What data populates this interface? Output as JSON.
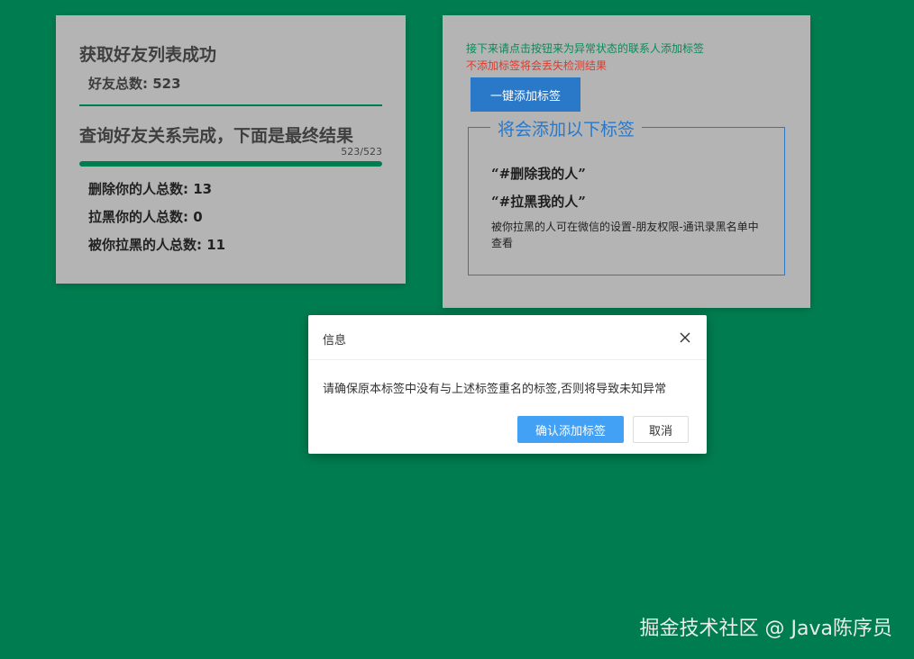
{
  "left_card": {
    "title": "获取好友列表成功",
    "friend_total": "好友总数: 523",
    "relation_title": "查询好友关系完成，下面是最终结果",
    "progress": {
      "text": "523/523",
      "fraction": 1.0
    },
    "stats": [
      "删除你的人总数: 13",
      "拉黑你的人总数: 0",
      "被你拉黑的人总数: 11"
    ]
  },
  "right_card": {
    "hint_green": "接下来请点击按钮来为异常状态的联系人添加标签",
    "hint_red": "不添加标签将会丢失检测结果",
    "add_tags_button": "一键添加标签",
    "legend": "将会添加以下标签",
    "tags": [
      "“#删除我的人”",
      "“#拉黑我的人”"
    ],
    "note": "被你拉黑的人可在微信的设置-朋友权限-通讯录黑名单中查看"
  },
  "dialog": {
    "title": "信息",
    "message": "请确保原本标签中没有与上述标签重名的标签,否则将导致未知异常",
    "confirm_label": "确认添加标签",
    "cancel_label": "取消"
  },
  "watermark": "掘金技术社区 @ Java陈序员",
  "colors": {
    "background": "#007d50",
    "card": "#b4b4b4",
    "accent_blue": "#2a78c8",
    "confirm_blue": "#42a0f5",
    "hint_green": "#0a8a5a",
    "hint_red": "#e03a2a"
  }
}
